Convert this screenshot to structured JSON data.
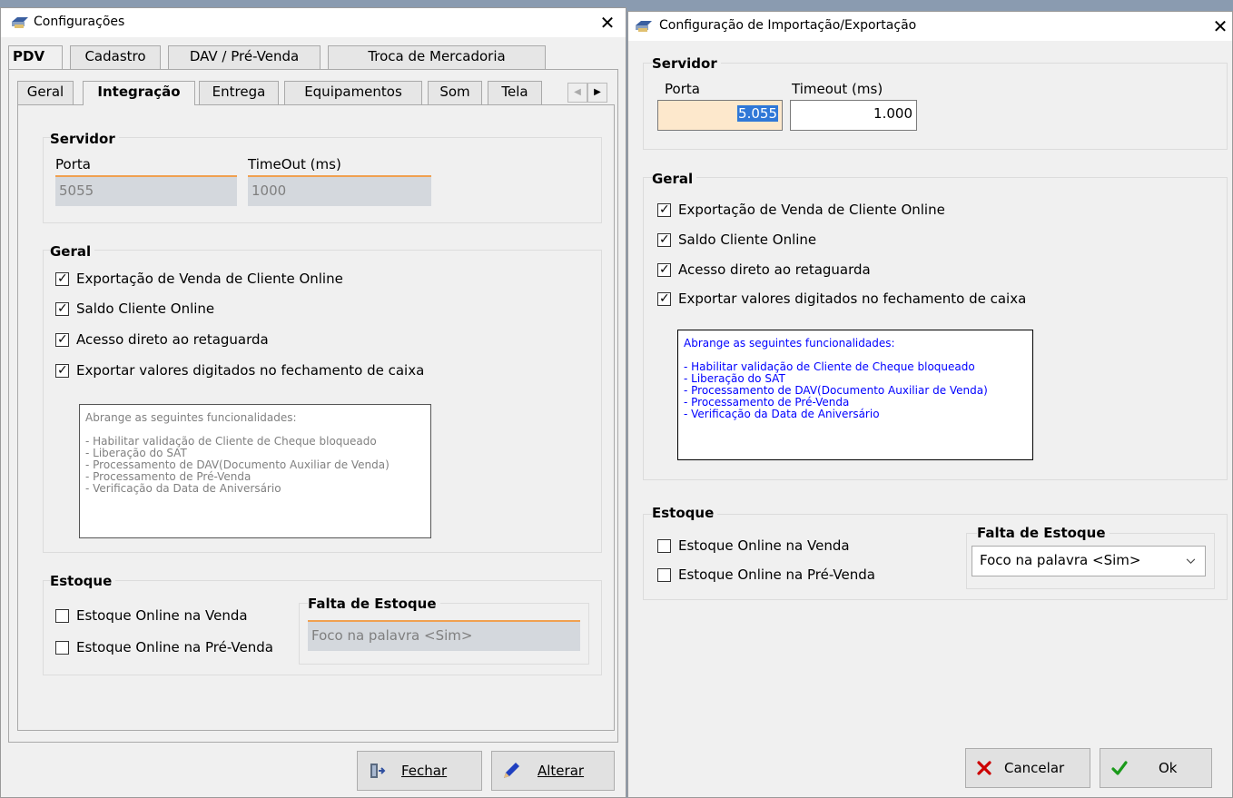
{
  "left": {
    "title": "Configurações",
    "outer_tabs": [
      "PDV",
      "Cadastro",
      "DAV / Pré-Venda",
      "Troca de Mercadoria"
    ],
    "inner_tabs": [
      "Geral",
      "Integração",
      "Entrega",
      "Equipamentos",
      "Som",
      "Tela"
    ],
    "servidor": {
      "title": "Servidor",
      "porta_label": "Porta",
      "porta_value": "5055",
      "timeout_label": "TimeOut (ms)",
      "timeout_value": "1000"
    },
    "geral": {
      "title": "Geral",
      "checks": [
        {
          "label": "Exportação de Venda de Cliente Online",
          "checked": true
        },
        {
          "label": "Saldo Cliente Online",
          "checked": true
        },
        {
          "label": "Acesso direto ao retaguarda",
          "checked": true
        },
        {
          "label": "Exportar valores digitados no fechamento de caixa",
          "checked": true
        }
      ],
      "info_heading": "Abrange as seguintes funcionalidades:",
      "info_lines": [
        "- Habilitar validação de Cliente de Cheque bloqueado",
        "- Liberação do SAT",
        "- Processamento de DAV(Documento Auxiliar de Venda)",
        "- Processamento de Pré-Venda",
        "- Verificação da Data de Aniversário"
      ]
    },
    "estoque": {
      "title": "Estoque",
      "checks": [
        {
          "label": "Estoque Online na Venda",
          "checked": false
        },
        {
          "label": "Estoque Online na Pré-Venda",
          "checked": false
        }
      ],
      "falta_title": "Falta de Estoque",
      "falta_value": "Foco na palavra <Sim>"
    },
    "buttons": {
      "fechar": "Fechar",
      "alterar": "Alterar"
    }
  },
  "right": {
    "title": "Configuração de Importação/Exportação",
    "servidor": {
      "title": "Servidor",
      "porta_label": "Porta",
      "porta_value": "5.055",
      "timeout_label": "Timeout (ms)",
      "timeout_value": "1.000"
    },
    "geral": {
      "title": "Geral",
      "checks": [
        {
          "label": "Exportação de Venda de Cliente Online",
          "checked": true
        },
        {
          "label": "Saldo Cliente Online",
          "checked": true
        },
        {
          "label": "Acesso direto ao retaguarda",
          "checked": true
        },
        {
          "label": "Exportar valores digitados no fechamento de caixa",
          "checked": true
        }
      ],
      "info_heading": "Abrange as seguintes funcionalidades:",
      "info_lines": [
        "- Habilitar validação de Cliente de Cheque bloqueado",
        "- Liberação do SAT",
        "- Processamento de DAV(Documento Auxiliar de Venda)",
        "- Processamento de Pré-Venda",
        "- Verificação da Data de Aniversário"
      ]
    },
    "estoque": {
      "title": "Estoque",
      "checks": [
        {
          "label": "Estoque Online na Venda",
          "checked": false
        },
        {
          "label": "Estoque Online na Pré-Venda",
          "checked": false
        }
      ],
      "falta_title": "Falta de Estoque",
      "falta_value": "Foco na palavra <Sim>"
    },
    "buttons": {
      "cancelar": "Cancelar",
      "ok": "Ok"
    }
  },
  "colors": {
    "readonly_field_bg": "#d4d8dd",
    "readonly_field_text": "#7f7f7f",
    "field_accent": "#f0a050",
    "focused_field_bg": "#fde8cc",
    "selection_bg": "#3078d7",
    "info_text_disabled": "#808080",
    "info_text_active": "#0000ff",
    "cancel_icon": "#cc0000",
    "ok_icon": "#1a9a1a"
  },
  "icons": {
    "title": "printer-icon",
    "close": "close-icon",
    "check": "checkmark-icon",
    "fechar": "exit-door-icon",
    "alterar": "pencil-icon",
    "cancelar": "x-icon",
    "ok": "ok-check-icon",
    "dropdown": "chevron-down-icon"
  }
}
